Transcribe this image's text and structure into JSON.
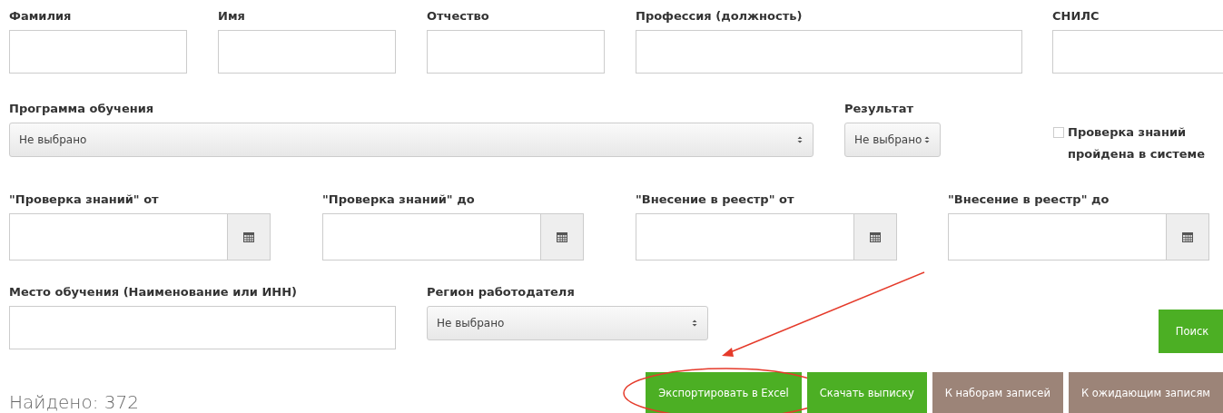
{
  "row1": [
    {
      "label": "Фамилия",
      "kind": "input"
    },
    {
      "label": "Имя",
      "kind": "input"
    },
    {
      "label": "Отчество",
      "kind": "input"
    },
    {
      "label": "Профессия (должность)",
      "kind": "input"
    },
    {
      "label": "СНИЛС",
      "kind": "input"
    }
  ],
  "program": {
    "label": "Программа обучения",
    "value": "Не выбрано"
  },
  "result": {
    "label": "Результат",
    "value": "Не выбрано"
  },
  "knowledge_check": {
    "label": "Проверка знаний пройдена в системе",
    "checked": false
  },
  "dates": [
    {
      "label": "\"Проверка знаний\" от"
    },
    {
      "label": "\"Проверка знаний\" до"
    },
    {
      "label": "\"Внесение в реестр\" от"
    },
    {
      "label": "\"Внесение в реестр\" до"
    }
  ],
  "place": {
    "label": "Место обучения (Наименование или ИНН)"
  },
  "region": {
    "label": "Регион работодателя",
    "value": "Не выбрано"
  },
  "search_button": "Поиск",
  "found": "Найдено: 372",
  "actions": [
    {
      "label": "Экспортировать в Excel",
      "kind": "primary"
    },
    {
      "label": "Скачать выписку",
      "kind": "primary"
    },
    {
      "label": "К наборам записей",
      "kind": "secondary"
    },
    {
      "label": "К ожидающим записям",
      "kind": "secondary"
    }
  ]
}
